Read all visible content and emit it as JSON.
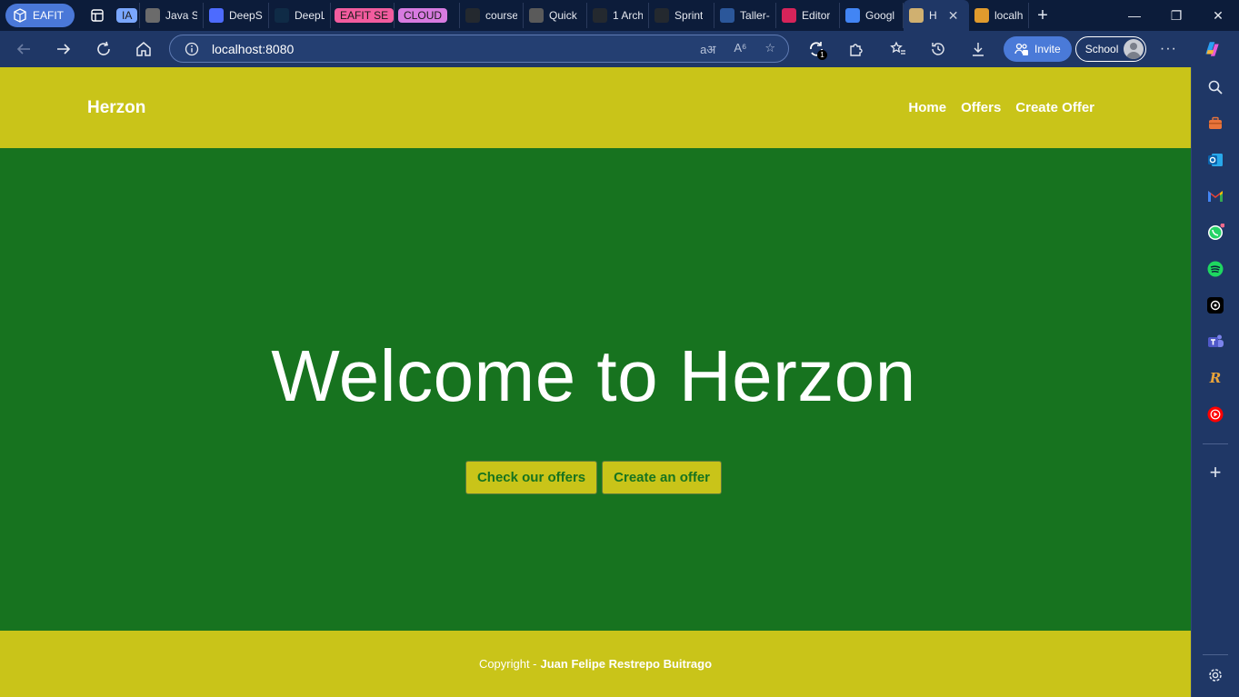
{
  "browser": {
    "profile_label": "EAFIT",
    "tabs": [
      {
        "title": "IA",
        "kind": "group",
        "color": "#7aa7ff"
      },
      {
        "title": "Java St",
        "kind": "tab",
        "fav_color": "#6b6b6b"
      },
      {
        "title": "DeepS",
        "kind": "tab",
        "fav_color": "#4d6bfe"
      },
      {
        "title": "DeepL",
        "kind": "tab",
        "fav_color": "#0f2b46"
      },
      {
        "title": "EAFIT SE",
        "kind": "group",
        "color": "#f25c9e"
      },
      {
        "title": "CLOUD",
        "kind": "group",
        "color": "#d77be0"
      },
      {
        "title": "course",
        "kind": "tab",
        "fav_color": "#24292f"
      },
      {
        "title": "Quick",
        "kind": "tab",
        "fav_color": "#5a5a5a"
      },
      {
        "title": "1 Arch",
        "kind": "tab",
        "fav_color": "#24292f"
      },
      {
        "title": "Sprint",
        "kind": "tab",
        "fav_color": "#24292f"
      },
      {
        "title": "Taller-",
        "kind": "tab",
        "fav_color": "#2b579a"
      },
      {
        "title": "Editor",
        "kind": "tab",
        "fav_color": "#d6245a"
      },
      {
        "title": "Googl",
        "kind": "tab",
        "fav_color": "#4285f4"
      },
      {
        "title": "H",
        "kind": "active",
        "fav_color": "#d0b070"
      },
      {
        "title": "localh",
        "kind": "tab",
        "fav_color": "#e09b2d"
      }
    ],
    "address": "localhost:8080",
    "invite_label": "Invite",
    "school_label": "School",
    "sync_badge": "1",
    "accent": "#4a7ad8"
  },
  "site": {
    "brand": "Herzon",
    "nav": {
      "home": "Home",
      "offers": "Offers",
      "create_offer": "Create Offer"
    },
    "hero_title": "Welcome to Herzon",
    "buttons": {
      "check_offers": "Check our offers",
      "create_offer": "Create an offer"
    },
    "footer": {
      "prefix": "Copyright -",
      "author": "Juan Felipe Restrepo Buitrago"
    },
    "colors": {
      "primary_green": "#17731f",
      "accent_yellow": "#c9c419"
    }
  },
  "sidebar": {
    "icons": [
      "search-icon",
      "briefcase-icon",
      "outlook-icon",
      "gmail-icon",
      "whatsapp-icon",
      "spotify-icon",
      "chatgpt-icon",
      "teams-icon",
      "r-icon",
      "youtube-music-icon",
      "add-icon",
      "settings-icon"
    ]
  }
}
